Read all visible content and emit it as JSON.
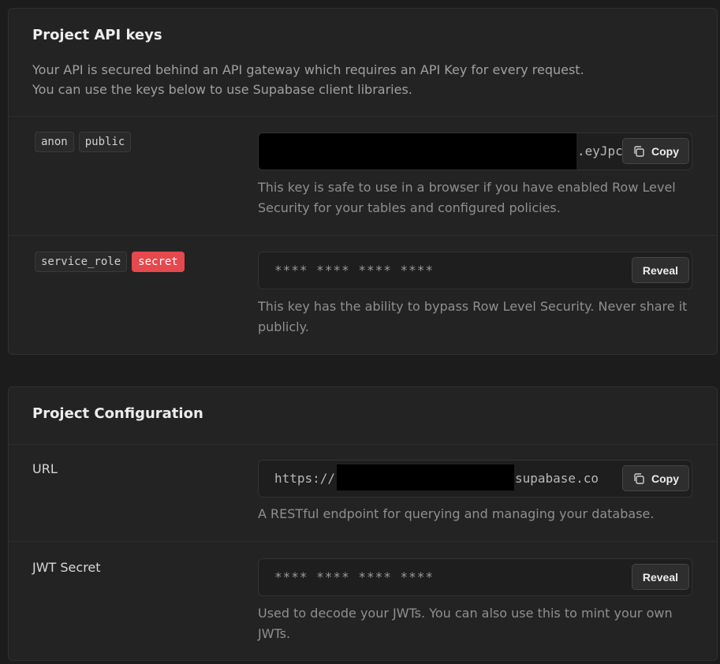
{
  "api_keys": {
    "title": "Project API keys",
    "description_line1": "Your API is secured behind an API gateway which requires an API Key for every request.",
    "description_line2": "You can use the keys below to use Supabase client libraries.",
    "anon": {
      "tags": [
        "anon",
        "public"
      ],
      "value_visible": ".eyJpc",
      "button_label": "Copy",
      "help": "This key is safe to use in a browser if you have enabled Row Level Security for your tables and configured policies."
    },
    "service_role": {
      "tags": [
        "service_role",
        "secret"
      ],
      "value_masked": "**** **** **** ****",
      "button_label": "Reveal",
      "help": "This key has the ability to bypass Row Level Security. Never share it publicly."
    }
  },
  "config": {
    "title": "Project Configuration",
    "url": {
      "label": "URL",
      "value_prefix": "https://",
      "value_suffix": "supabase.co",
      "button_label": "Copy",
      "help": "A RESTful endpoint for querying and managing your database."
    },
    "jwt": {
      "label": "JWT Secret",
      "value_masked": "**** **** **** ****",
      "button_label": "Reveal",
      "help": "Used to decode your JWTs. You can also use this to mint your own JWTs."
    }
  },
  "icons": {
    "copy": "copy-icon"
  },
  "colors": {
    "secret_tag": "#e5484d",
    "background": "#1c1c1c",
    "panel": "#232323"
  }
}
